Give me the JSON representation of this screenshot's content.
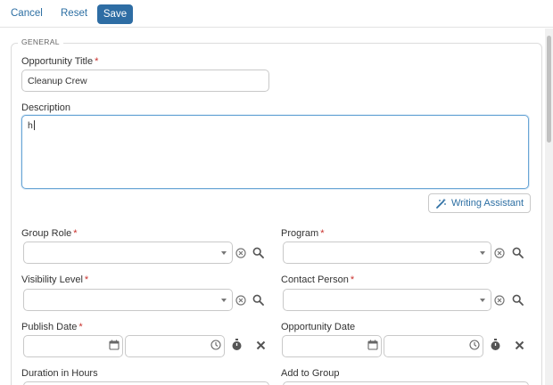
{
  "toolbar": {
    "cancel": "Cancel",
    "reset": "Reset",
    "save": "Save"
  },
  "section": {
    "legend": "GENERAL"
  },
  "fields": {
    "title": {
      "label": "Opportunity Title",
      "required": "*",
      "value": "Cleanup Crew"
    },
    "description": {
      "label": "Description",
      "value": "h"
    },
    "writing_assistant": {
      "label": "Writing Assistant"
    },
    "group_role": {
      "label": "Group Role",
      "required": "*"
    },
    "program": {
      "label": "Program",
      "required": "*"
    },
    "visibility_level": {
      "label": "Visibility Level",
      "required": "*"
    },
    "contact_person": {
      "label": "Contact Person",
      "required": "*"
    },
    "publish_date": {
      "label": "Publish Date",
      "required": "*"
    },
    "opportunity_date": {
      "label": "Opportunity Date"
    },
    "duration": {
      "label": "Duration in Hours"
    },
    "add_to_group": {
      "label": "Add to Group"
    }
  },
  "colors": {
    "accent": "#2e6da4",
    "link": "#2d6fa3",
    "required": "#c9302c",
    "focus_border": "#6aa6d6"
  },
  "icons": {
    "select_clear": "circle-x-icon",
    "select_search": "search-icon",
    "date": "calendar-icon",
    "time": "clock-icon",
    "now": "stopwatch-icon",
    "clear": "close-icon",
    "wand": "magic-wand-icon"
  }
}
